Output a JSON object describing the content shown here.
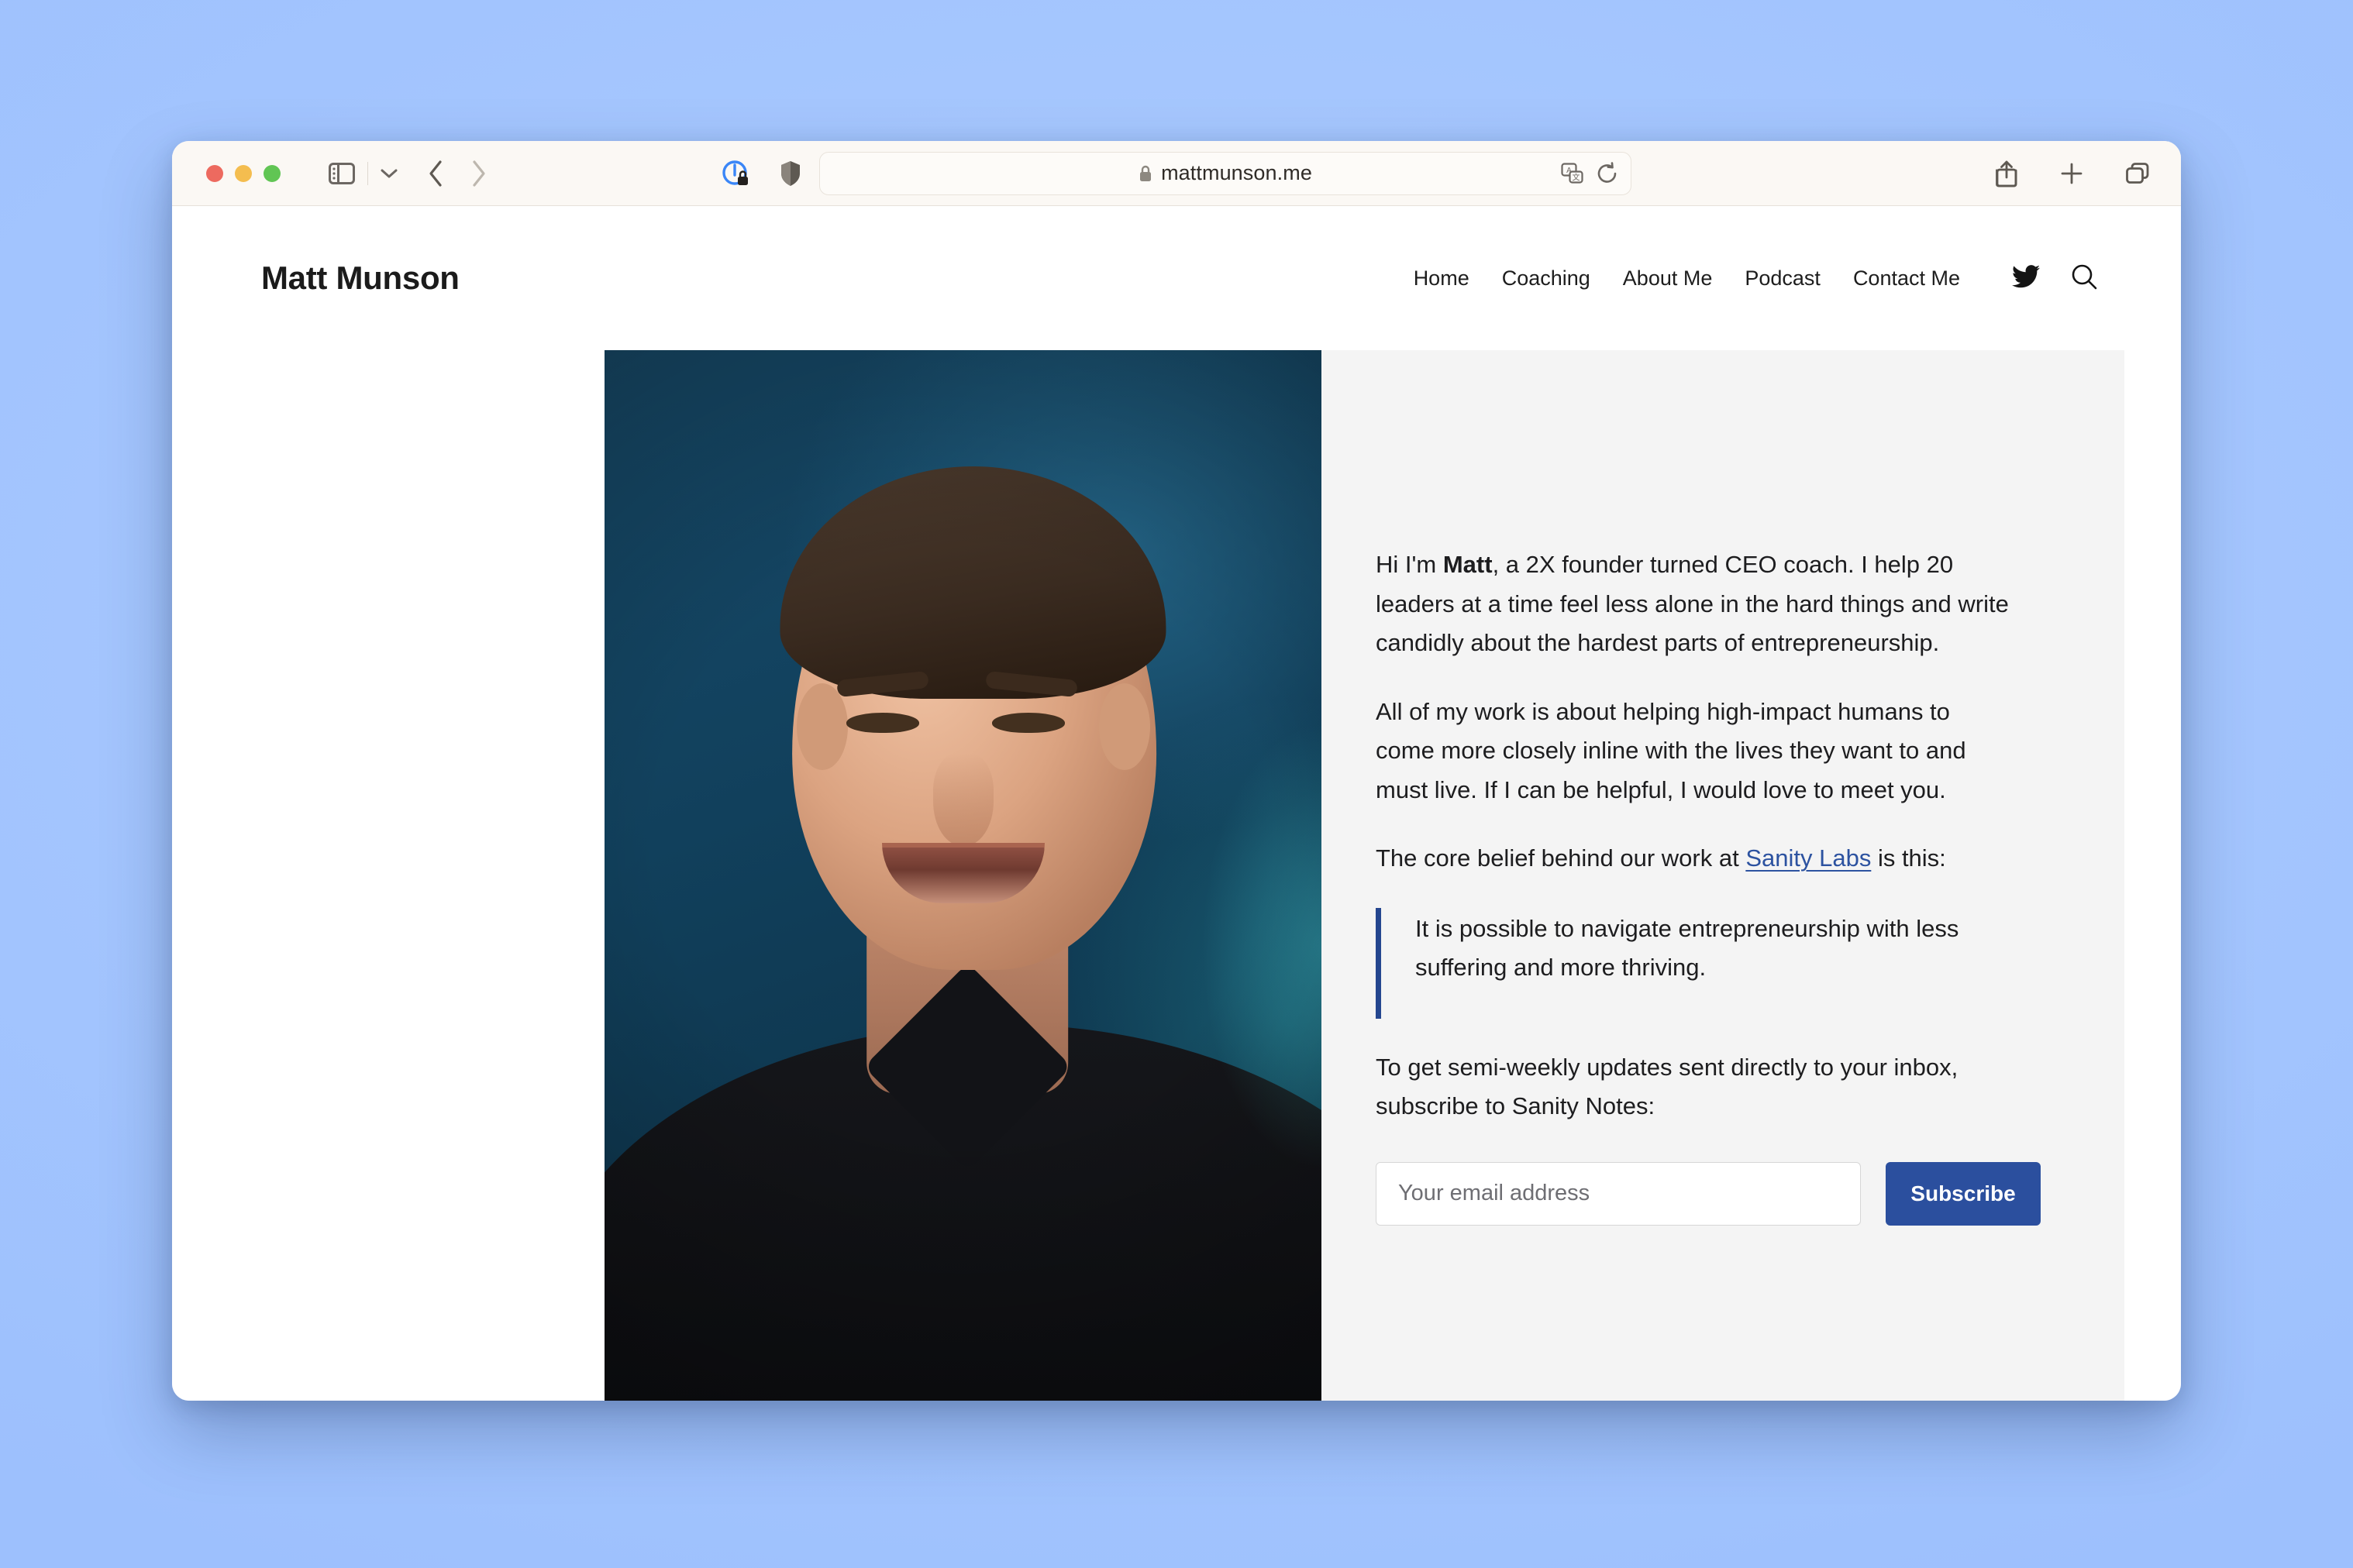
{
  "browser": {
    "traffic_lights": [
      "close",
      "minimize",
      "zoom"
    ],
    "sidebar_icon": "sidebar-icon",
    "sidebar_chevron_icon": "chevron-down-icon",
    "back_icon": "chevron-left-icon",
    "forward_icon": "chevron-right-icon",
    "privacy_report_icon": "privacy-report-icon",
    "shield_icon": "shield-icon",
    "lock_icon": "lock-icon",
    "url": "mattmunson.me",
    "translate_icon": "translate-icon",
    "reload_icon": "reload-icon",
    "share_icon": "share-icon",
    "new_tab_icon": "plus-icon",
    "tab_overview_icon": "tab-overview-icon"
  },
  "site": {
    "brand": "Matt Munson",
    "nav": [
      {
        "label": "Home"
      },
      {
        "label": "Coaching"
      },
      {
        "label": "About Me"
      },
      {
        "label": "Podcast"
      },
      {
        "label": "Contact Me"
      }
    ],
    "nav_icons": {
      "twitter": "twitter-icon",
      "search": "search-icon"
    }
  },
  "hero": {
    "photo_alt": "Portrait of Matt Munson",
    "intro": {
      "lead_before": "Hi I'm ",
      "lead_name": "Matt",
      "lead_after": ", a 2X founder turned CEO coach. I help 20 leaders at a time feel less alone in the hard things and write candidly about the hardest parts of entrepreneurship."
    },
    "paragraph_2": "All of my work is about helping high-impact humans to come more closely inline with the lives they want to and must live. If I can be helpful, I would love to meet you.",
    "belief": {
      "before_link": "The core belief behind our work at ",
      "link_text": "Sanity Labs",
      "after_link": " is this:"
    },
    "quote": "It is possible to navigate entrepreneurship with less suffering and more thriving.",
    "subscribe_prompt": "To get semi-weekly updates sent directly to your inbox, subscribe to Sanity Notes:",
    "email_placeholder": "Your email address",
    "email_value": "",
    "subscribe_label": "Subscribe"
  },
  "colors": {
    "desktop_background": "#a9caff",
    "toolbar_background": "#fbf8f4",
    "panel_background": "#f4f4f4",
    "link_blue": "#2c52a0",
    "quote_border_blue": "#24468f",
    "button_blue": "#2b4f9e",
    "photo_backdrop": "#13405c"
  }
}
